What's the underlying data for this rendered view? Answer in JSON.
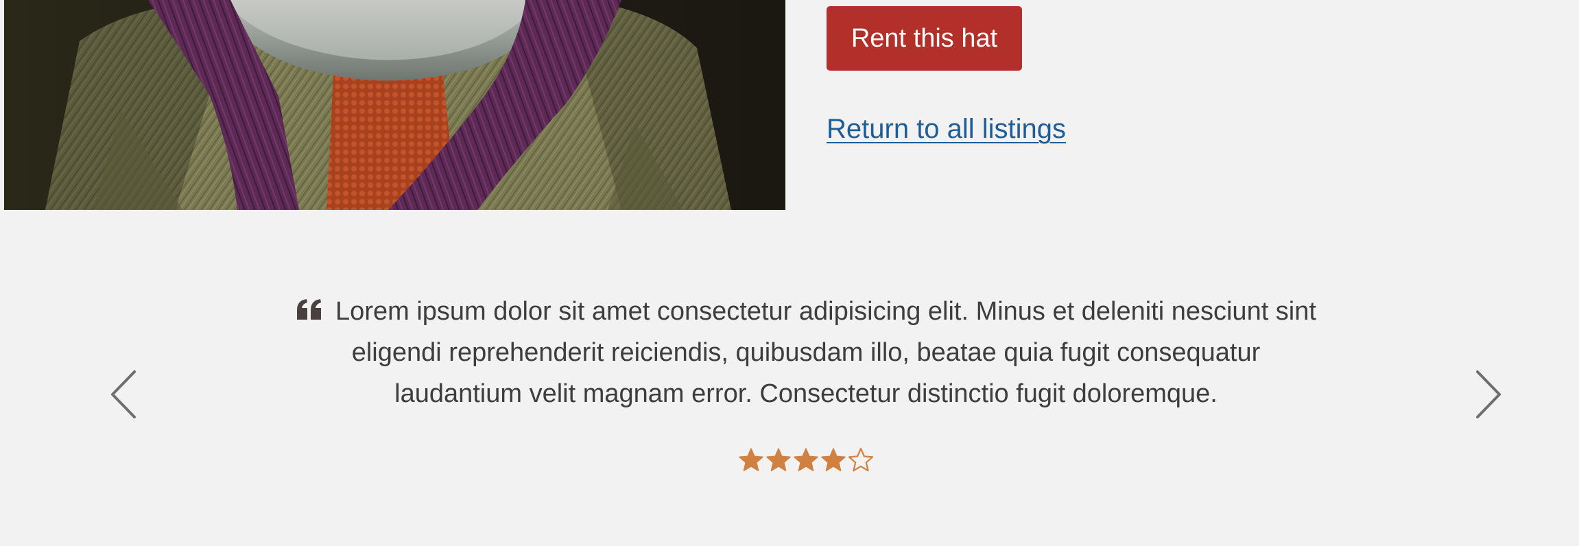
{
  "listing": {
    "image_alt": "Hat model wearing a tweed coat and purple scarf",
    "rent_button_label": "Rent this hat",
    "return_link_label": "Return to all listings"
  },
  "testimonial": {
    "quote": "Lorem ipsum dolor sit amet consectetur adipisicing elit. Minus et deleniti nesciunt sint eligendi reprehenderit reiciendis, quibusdam illo, beatae quia fugit consequatur laudantium velit magnam error. Consectetur distinctio fugit doloremque.",
    "rating": 4,
    "rating_max": 5,
    "quote_icon": "quote-left-icon",
    "prev_icon": "chevron-left-icon",
    "next_icon": "chevron-right-icon"
  },
  "colors": {
    "background": "#f2f2f2",
    "accent_button": "#b3302a",
    "link": "#1f5d96",
    "star": "#d08040",
    "text": "#3d3d3d",
    "arrow": "#6e6e6e"
  }
}
